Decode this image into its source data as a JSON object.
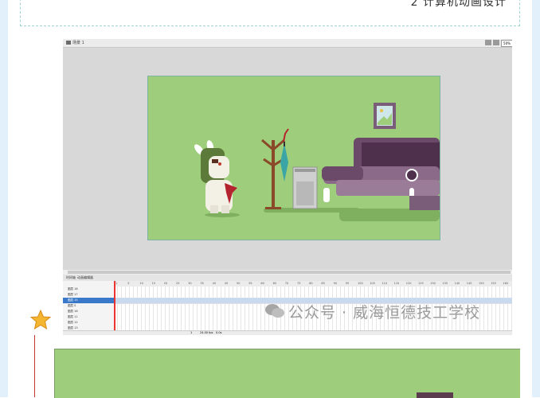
{
  "header": {
    "title": "2 计算机动画设计"
  },
  "app": {
    "scene_label": "场景 1",
    "zoom": "50%",
    "timeline_tabs": [
      "时间轴",
      "动画编辑器"
    ],
    "ruler_ticks": [
      "1",
      "5",
      "10",
      "15",
      "20",
      "25",
      "30",
      "35",
      "40",
      "45",
      "50",
      "55",
      "60",
      "65",
      "70",
      "75",
      "80",
      "85",
      "90",
      "95",
      "100",
      "105",
      "110",
      "115",
      "120",
      "125",
      "130",
      "135",
      "140",
      "145",
      "150",
      "155",
      "160"
    ],
    "layers": [
      {
        "name": "图层 18"
      },
      {
        "name": "图层 17"
      },
      {
        "name": "图层 15"
      },
      {
        "name": "图层 5"
      },
      {
        "name": "图层 16"
      },
      {
        "name": "图层 11"
      },
      {
        "name": "图层 12"
      },
      {
        "name": "图层 13"
      }
    ],
    "status": [
      "1",
      "24.00 fps",
      "0.0s"
    ]
  },
  "watermark": {
    "text": "公众号 · 威海恒德技工学校"
  },
  "colors": {
    "stage_bg": "#9ecd7c",
    "sofa": "#7a5d78",
    "selected_layer": "#3a79c9"
  }
}
